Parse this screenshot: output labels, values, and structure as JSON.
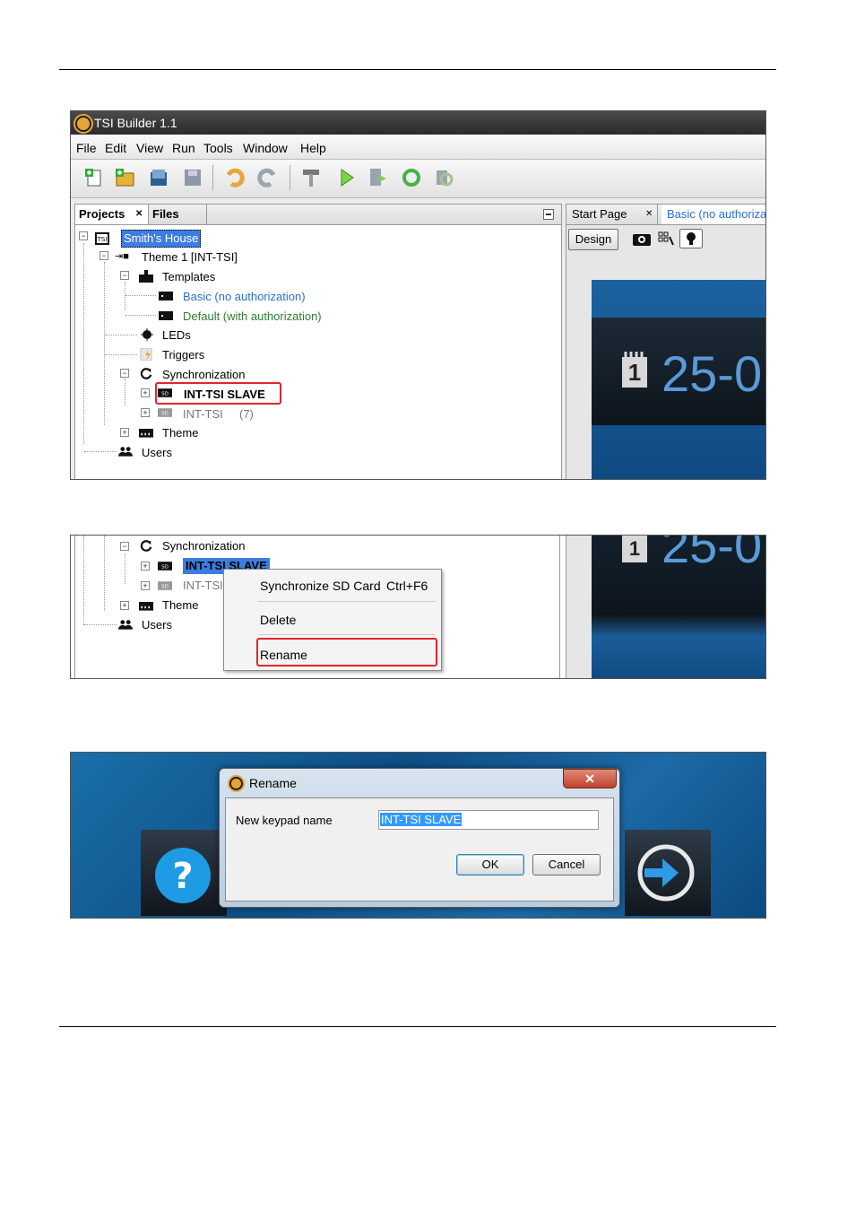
{
  "app": {
    "title": "TSI Builder 1.1"
  },
  "menu": [
    "File",
    "Edit",
    "View",
    "Run",
    "Tools",
    "Window",
    "Help"
  ],
  "panel_tabs": {
    "projects": "Projects",
    "files": "Files"
  },
  "editor_tabs": {
    "start_page": "Start Page",
    "basic": "Basic (no authoriza"
  },
  "editor_toolbar": {
    "design": "Design"
  },
  "tree": {
    "project": "Smith's House",
    "theme1": "Theme 1 [INT-TSI]",
    "templates": "Templates",
    "template_basic": "Basic (no authorization)",
    "template_default": "Default (with authorization)",
    "leds": "LEDs",
    "triggers": "Triggers",
    "synchronization": "Synchronization",
    "slave": "INT-TSI SLAVE",
    "int_tsi": "INT-TSI",
    "int_tsi_count": "(7)",
    "theme": "Theme",
    "users": "Users"
  },
  "preview": {
    "day": "1",
    "date": "25-0"
  },
  "context_menu": {
    "sync": "Synchronize SD Card",
    "sync_shortcut": "Ctrl+F6",
    "delete": "Delete",
    "rename": "Rename"
  },
  "dialog": {
    "title": "Rename",
    "label": "New keypad name",
    "value": "INT-TSI SLAVE",
    "ok": "OK",
    "cancel": "Cancel"
  },
  "colors": {
    "accent_blue": "#3d7de0",
    "link_blue": "#2a6fd6",
    "link_green": "#2f7d32",
    "highlight_red": "#e0262b"
  }
}
